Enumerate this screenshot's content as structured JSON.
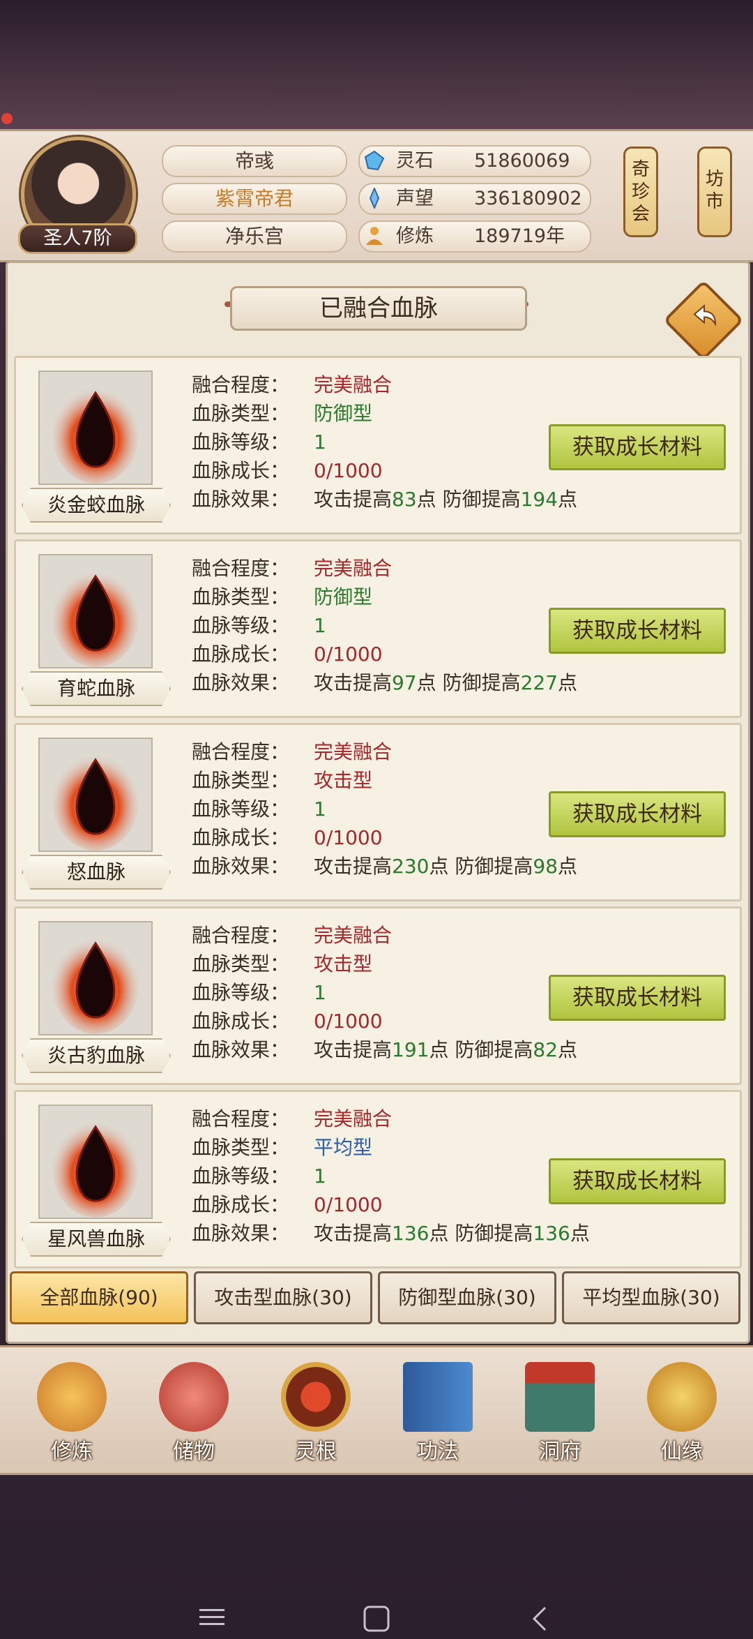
{
  "header": {
    "player_name": "帝彧",
    "title": "紫霄帝君",
    "sect": "净乐宫",
    "rank": "圣人7阶",
    "resources": [
      {
        "icon": "spirit-stone-icon",
        "label": "灵石",
        "value": "51860069"
      },
      {
        "icon": "prestige-icon",
        "label": "声望",
        "value": "336180902"
      },
      {
        "icon": "cultivation-icon",
        "label": "修炼",
        "value": "189719年"
      }
    ],
    "shops": [
      {
        "label": "奇\n珍\n会"
      },
      {
        "label": "坊\n市"
      }
    ]
  },
  "panel": {
    "title": "已融合血脉",
    "back_icon": "back-arrow-icon"
  },
  "field_labels": {
    "fusion": "融合程度：",
    "type": "血脉类型：",
    "level": "血脉等级：",
    "growth": "血脉成长：",
    "effect": "血脉效果："
  },
  "bloodlines": [
    {
      "name": "炎金蛟血脉",
      "fusion": "完美融合",
      "type": "防御型",
      "type_color": "green",
      "level": "1",
      "growth": "0/1000",
      "atk": "83",
      "def": "194",
      "button": "获取成长材料"
    },
    {
      "name": "育蛇血脉",
      "fusion": "完美融合",
      "type": "防御型",
      "type_color": "green",
      "level": "1",
      "growth": "0/1000",
      "atk": "97",
      "def": "227",
      "button": "获取成长材料"
    },
    {
      "name": "惄血脉",
      "fusion": "完美融合",
      "type": "攻击型",
      "type_color": "red",
      "level": "1",
      "growth": "0/1000",
      "atk": "230",
      "def": "98",
      "button": "获取成长材料"
    },
    {
      "name": "炎古豹血脉",
      "fusion": "完美融合",
      "type": "攻击型",
      "type_color": "red",
      "level": "1",
      "growth": "0/1000",
      "atk": "191",
      "def": "82",
      "button": "获取成长材料"
    },
    {
      "name": "星风兽血脉",
      "fusion": "完美融合",
      "type": "平均型",
      "type_color": "blue",
      "level": "1",
      "growth": "0/1000",
      "atk": "136",
      "def": "136",
      "button": "获取成长材料"
    }
  ],
  "effect_text": {
    "atk_prefix": "攻击提高",
    "def_prefix": "防御提高",
    "suffix": "点"
  },
  "filters": [
    {
      "label": "全部血脉(90)",
      "active": true
    },
    {
      "label": "攻击型血脉(30)",
      "active": false
    },
    {
      "label": "防御型血脉(30)",
      "active": false
    },
    {
      "label": "平均型血脉(30)",
      "active": false
    }
  ],
  "bottom_nav": [
    {
      "label": "修炼",
      "icon": "cultivate-icon"
    },
    {
      "label": "储物",
      "icon": "storage-bag-icon"
    },
    {
      "label": "灵根",
      "icon": "spirit-root-icon"
    },
    {
      "label": "功法",
      "icon": "manual-book-icon"
    },
    {
      "label": "洞府",
      "icon": "cave-dwelling-icon"
    },
    {
      "label": "仙缘",
      "icon": "immortal-fate-icon"
    }
  ],
  "colors": {
    "red": "#a6262a",
    "green": "#2a7a2e",
    "blue": "#2c5cab",
    "button": "#c5d55a"
  }
}
